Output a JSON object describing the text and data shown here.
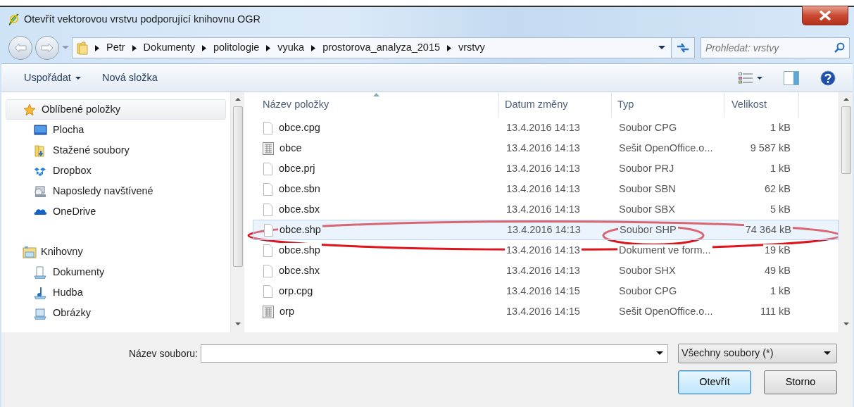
{
  "window": {
    "title": "Otevřít vektorovou vrstvu podporující knihovnu OGR"
  },
  "address_bar": {
    "path": [
      "Petr",
      "Dokumenty",
      "politologie",
      "vyuka",
      "prostorova_analyza_2015",
      "vrstvy"
    ]
  },
  "search": {
    "placeholder": "Prohledat: vrstvy"
  },
  "toolbar": {
    "buttons": [
      {
        "label": "Uspořádat",
        "dropdown": true
      },
      {
        "label": "Nová složka",
        "dropdown": false
      }
    ]
  },
  "sidebar": {
    "groups": [
      {
        "label": "Oblíbené položky",
        "kind": "favorites",
        "selected": true,
        "children": [
          {
            "label": "Plocha",
            "kind": "desktop",
            "selected": false
          },
          {
            "label": "Stažené soubory",
            "kind": "downloads",
            "selected": false
          },
          {
            "label": "Dropbox",
            "kind": "dropbox",
            "selected": false
          },
          {
            "label": "Naposledy navštívené",
            "kind": "recent",
            "selected": false
          },
          {
            "label": "OneDrive",
            "kind": "onedrive",
            "selected": false
          }
        ]
      },
      {
        "label": "Knihovny",
        "kind": "libraries",
        "selected": false,
        "children": [
          {
            "label": "Dokumenty",
            "kind": "documents",
            "selected": false
          },
          {
            "label": "Hudba",
            "kind": "music",
            "selected": false
          },
          {
            "label": "Obrázky",
            "kind": "pictures",
            "selected": false
          }
        ]
      }
    ]
  },
  "table": {
    "columns": [
      {
        "label": "Název položky",
        "sorted": true
      },
      {
        "label": "Datum změny",
        "sorted": false
      },
      {
        "label": "Typ",
        "sorted": false
      },
      {
        "label": "Velikost",
        "sorted": false
      }
    ],
    "rows": [
      {
        "name": "obce.cpg",
        "date": "13.4.2016 14:13",
        "type": "Soubor CPG",
        "size": "1 kB",
        "kind": "file",
        "selected": false
      },
      {
        "name": "obce",
        "date": "13.4.2016 14:13",
        "type": "Sešit OpenOffice.o...",
        "size": "9 587 kB",
        "kind": "spreadsheet",
        "selected": false
      },
      {
        "name": "obce.prj",
        "date": "13.4.2016 14:13",
        "type": "Soubor PRJ",
        "size": "1 kB",
        "kind": "file",
        "selected": false
      },
      {
        "name": "obce.sbn",
        "date": "13.4.2016 14:13",
        "type": "Soubor SBN",
        "size": "62 kB",
        "kind": "file",
        "selected": false
      },
      {
        "name": "obce.sbx",
        "date": "13.4.2016 14:13",
        "type": "Soubor SBX",
        "size": "5 kB",
        "kind": "file",
        "selected": false
      },
      {
        "name": "obce.shp",
        "date": "13.4.2016 14:13",
        "type": "Soubor SHP",
        "size": "74 364 kB",
        "kind": "file",
        "selected": true
      },
      {
        "name": "obce.shp",
        "date": "13.4.2016 14:13",
        "type": "Dokument ve form...",
        "size": "19 kB",
        "kind": "file",
        "selected": false
      },
      {
        "name": "obce.shx",
        "date": "13.4.2016 14:13",
        "type": "Soubor SHX",
        "size": "49 kB",
        "kind": "file",
        "selected": false
      },
      {
        "name": "orp.cpg",
        "date": "13.4.2016 14:15",
        "type": "Soubor CPG",
        "size": "1 kB",
        "kind": "file",
        "selected": false
      },
      {
        "name": "orp",
        "date": "13.4.2016 14:15",
        "type": "Sešit OpenOffice.o...",
        "size": "111 kB",
        "kind": "spreadsheet",
        "selected": false
      }
    ]
  },
  "footer": {
    "filename_label": "Název souboru:",
    "filter": "Všechny soubory (*)",
    "buttons": [
      {
        "label": "Otevřít",
        "default": true
      },
      {
        "label": "Storno",
        "default": false
      }
    ]
  }
}
